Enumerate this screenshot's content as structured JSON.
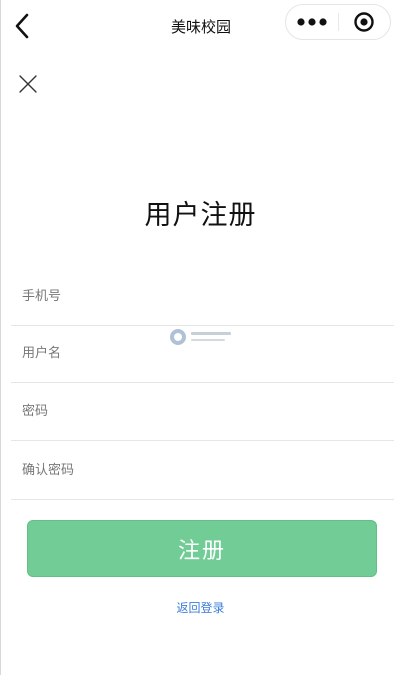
{
  "navbar": {
    "title": "美味校园",
    "back_icon": "chevron-left-icon",
    "more_icon": "more-dots-icon",
    "capsule_close_icon": "target-circle-icon"
  },
  "page": {
    "close_icon": "close-x-icon",
    "heading": "用户注册"
  },
  "form": {
    "phone": {
      "value": "",
      "placeholder": "手机号"
    },
    "username": {
      "value": "",
      "placeholder": "用户名"
    },
    "password": {
      "value": "",
      "placeholder": "密码"
    },
    "confirm_password": {
      "value": "",
      "placeholder": "确认密码"
    }
  },
  "actions": {
    "register_label": "注册",
    "back_to_login_label": "返回登录"
  },
  "colors": {
    "register_button": "#72cc96",
    "link": "#3b7dd8",
    "divider": "#e6e6e6"
  }
}
